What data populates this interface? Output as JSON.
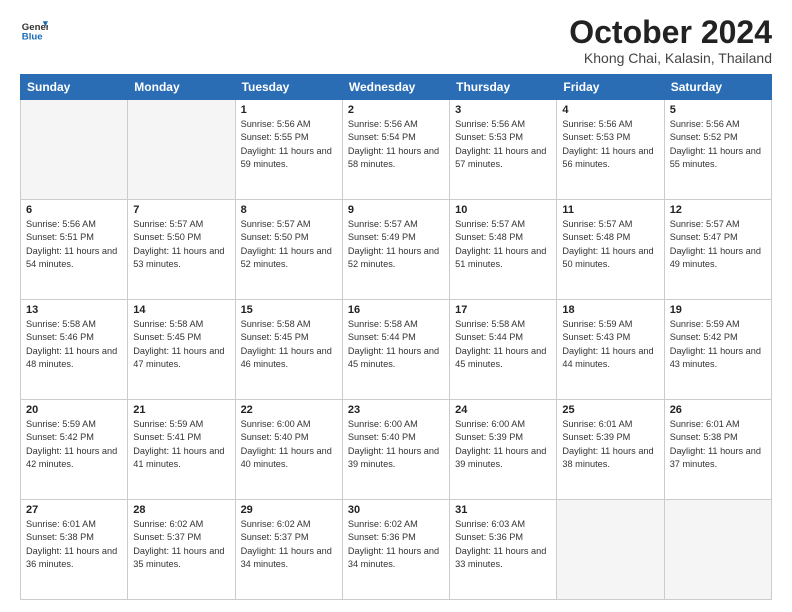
{
  "header": {
    "logo_line1": "General",
    "logo_line2": "Blue",
    "month": "October 2024",
    "location": "Khong Chai, Kalasin, Thailand"
  },
  "days_of_week": [
    "Sunday",
    "Monday",
    "Tuesday",
    "Wednesday",
    "Thursday",
    "Friday",
    "Saturday"
  ],
  "weeks": [
    [
      {
        "num": "",
        "info": ""
      },
      {
        "num": "",
        "info": ""
      },
      {
        "num": "1",
        "info": "Sunrise: 5:56 AM\nSunset: 5:55 PM\nDaylight: 11 hours and 59 minutes."
      },
      {
        "num": "2",
        "info": "Sunrise: 5:56 AM\nSunset: 5:54 PM\nDaylight: 11 hours and 58 minutes."
      },
      {
        "num": "3",
        "info": "Sunrise: 5:56 AM\nSunset: 5:53 PM\nDaylight: 11 hours and 57 minutes."
      },
      {
        "num": "4",
        "info": "Sunrise: 5:56 AM\nSunset: 5:53 PM\nDaylight: 11 hours and 56 minutes."
      },
      {
        "num": "5",
        "info": "Sunrise: 5:56 AM\nSunset: 5:52 PM\nDaylight: 11 hours and 55 minutes."
      }
    ],
    [
      {
        "num": "6",
        "info": "Sunrise: 5:56 AM\nSunset: 5:51 PM\nDaylight: 11 hours and 54 minutes."
      },
      {
        "num": "7",
        "info": "Sunrise: 5:57 AM\nSunset: 5:50 PM\nDaylight: 11 hours and 53 minutes."
      },
      {
        "num": "8",
        "info": "Sunrise: 5:57 AM\nSunset: 5:50 PM\nDaylight: 11 hours and 52 minutes."
      },
      {
        "num": "9",
        "info": "Sunrise: 5:57 AM\nSunset: 5:49 PM\nDaylight: 11 hours and 52 minutes."
      },
      {
        "num": "10",
        "info": "Sunrise: 5:57 AM\nSunset: 5:48 PM\nDaylight: 11 hours and 51 minutes."
      },
      {
        "num": "11",
        "info": "Sunrise: 5:57 AM\nSunset: 5:48 PM\nDaylight: 11 hours and 50 minutes."
      },
      {
        "num": "12",
        "info": "Sunrise: 5:57 AM\nSunset: 5:47 PM\nDaylight: 11 hours and 49 minutes."
      }
    ],
    [
      {
        "num": "13",
        "info": "Sunrise: 5:58 AM\nSunset: 5:46 PM\nDaylight: 11 hours and 48 minutes."
      },
      {
        "num": "14",
        "info": "Sunrise: 5:58 AM\nSunset: 5:45 PM\nDaylight: 11 hours and 47 minutes."
      },
      {
        "num": "15",
        "info": "Sunrise: 5:58 AM\nSunset: 5:45 PM\nDaylight: 11 hours and 46 minutes."
      },
      {
        "num": "16",
        "info": "Sunrise: 5:58 AM\nSunset: 5:44 PM\nDaylight: 11 hours and 45 minutes."
      },
      {
        "num": "17",
        "info": "Sunrise: 5:58 AM\nSunset: 5:44 PM\nDaylight: 11 hours and 45 minutes."
      },
      {
        "num": "18",
        "info": "Sunrise: 5:59 AM\nSunset: 5:43 PM\nDaylight: 11 hours and 44 minutes."
      },
      {
        "num": "19",
        "info": "Sunrise: 5:59 AM\nSunset: 5:42 PM\nDaylight: 11 hours and 43 minutes."
      }
    ],
    [
      {
        "num": "20",
        "info": "Sunrise: 5:59 AM\nSunset: 5:42 PM\nDaylight: 11 hours and 42 minutes."
      },
      {
        "num": "21",
        "info": "Sunrise: 5:59 AM\nSunset: 5:41 PM\nDaylight: 11 hours and 41 minutes."
      },
      {
        "num": "22",
        "info": "Sunrise: 6:00 AM\nSunset: 5:40 PM\nDaylight: 11 hours and 40 minutes."
      },
      {
        "num": "23",
        "info": "Sunrise: 6:00 AM\nSunset: 5:40 PM\nDaylight: 11 hours and 39 minutes."
      },
      {
        "num": "24",
        "info": "Sunrise: 6:00 AM\nSunset: 5:39 PM\nDaylight: 11 hours and 39 minutes."
      },
      {
        "num": "25",
        "info": "Sunrise: 6:01 AM\nSunset: 5:39 PM\nDaylight: 11 hours and 38 minutes."
      },
      {
        "num": "26",
        "info": "Sunrise: 6:01 AM\nSunset: 5:38 PM\nDaylight: 11 hours and 37 minutes."
      }
    ],
    [
      {
        "num": "27",
        "info": "Sunrise: 6:01 AM\nSunset: 5:38 PM\nDaylight: 11 hours and 36 minutes."
      },
      {
        "num": "28",
        "info": "Sunrise: 6:02 AM\nSunset: 5:37 PM\nDaylight: 11 hours and 35 minutes."
      },
      {
        "num": "29",
        "info": "Sunrise: 6:02 AM\nSunset: 5:37 PM\nDaylight: 11 hours and 34 minutes."
      },
      {
        "num": "30",
        "info": "Sunrise: 6:02 AM\nSunset: 5:36 PM\nDaylight: 11 hours and 34 minutes."
      },
      {
        "num": "31",
        "info": "Sunrise: 6:03 AM\nSunset: 5:36 PM\nDaylight: 11 hours and 33 minutes."
      },
      {
        "num": "",
        "info": ""
      },
      {
        "num": "",
        "info": ""
      }
    ]
  ]
}
